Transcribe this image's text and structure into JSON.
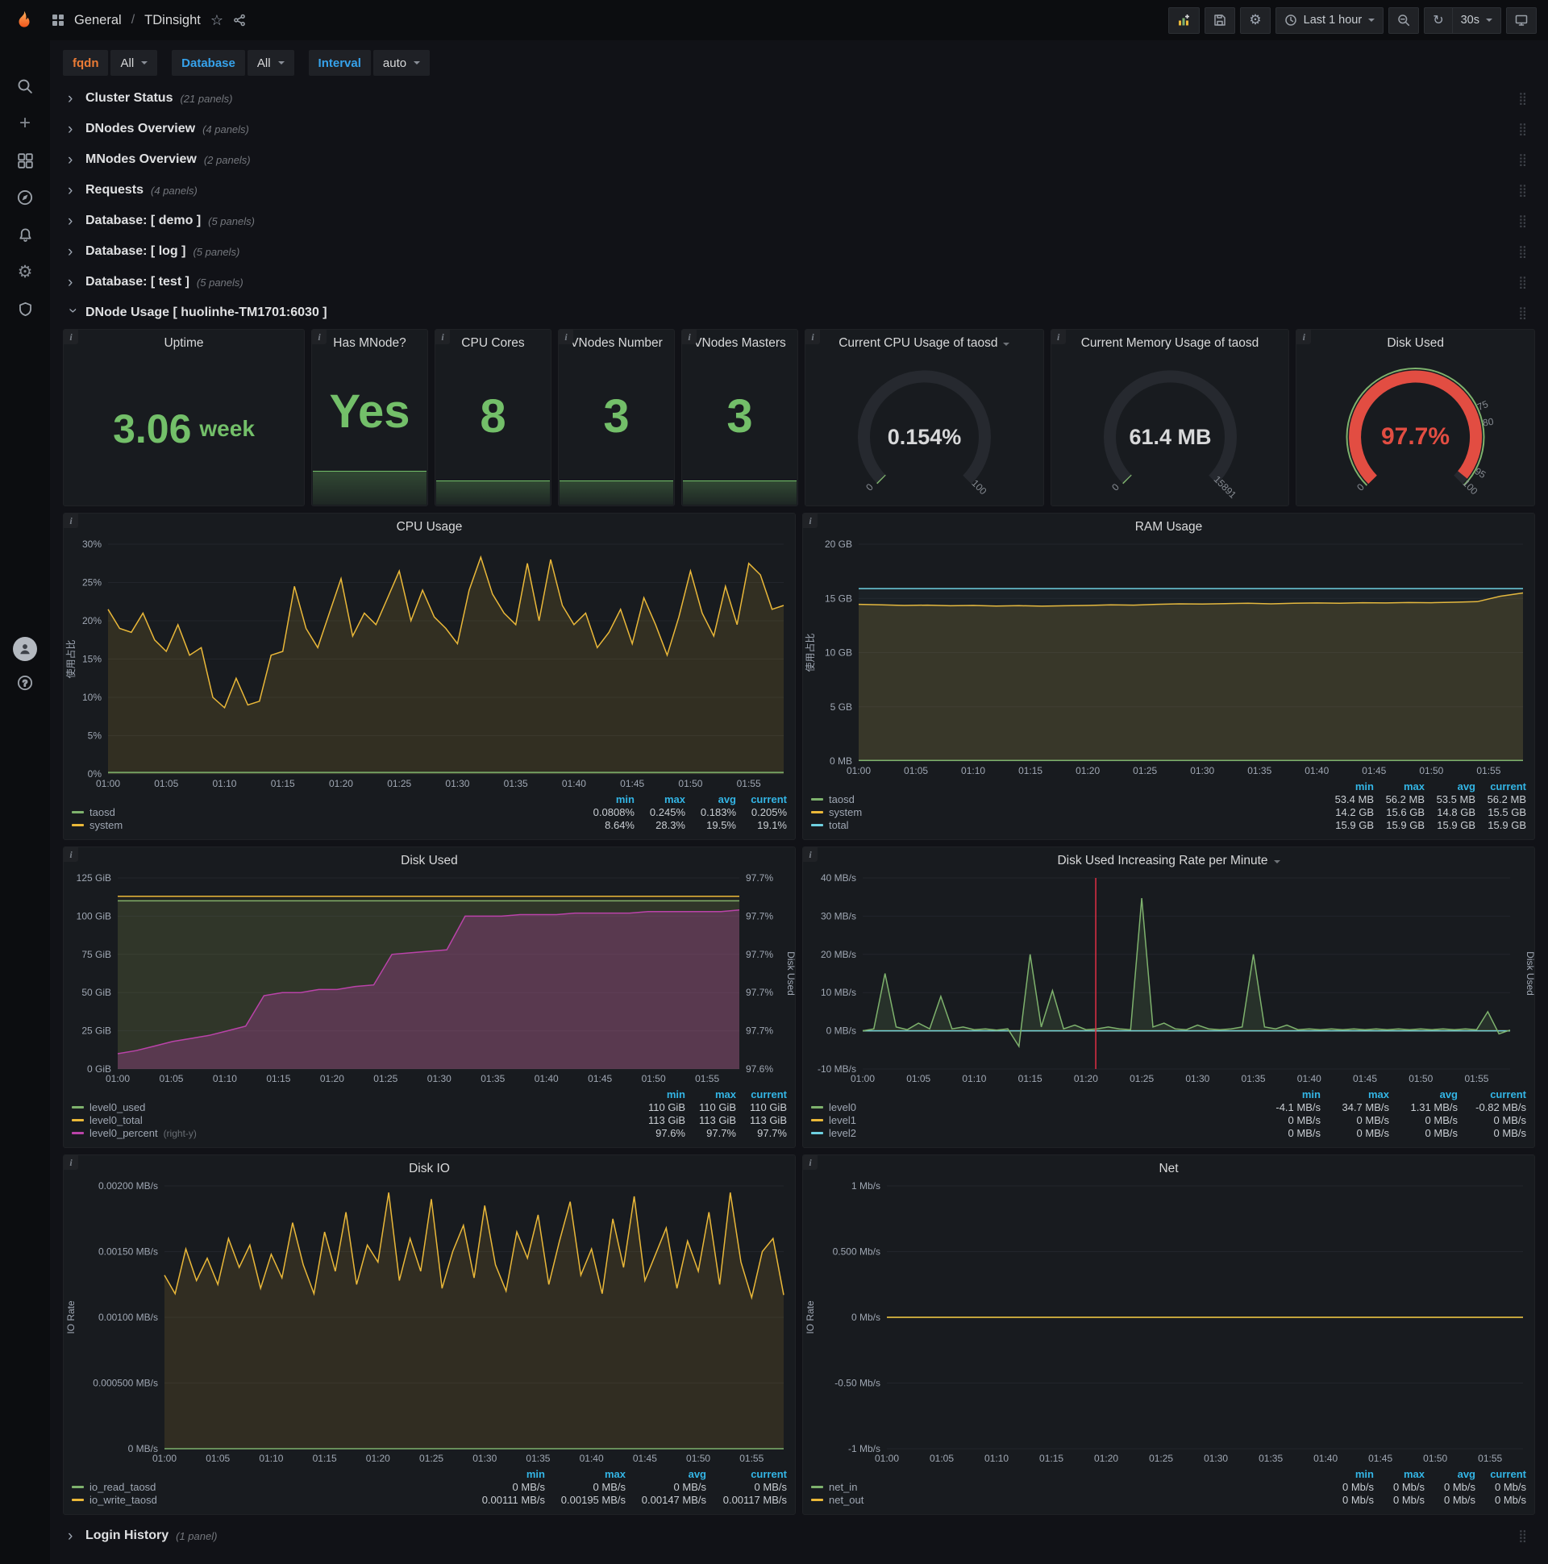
{
  "navbar": {
    "section": "General",
    "separator": "/",
    "dashboard": "TDinsight",
    "time_range": "Last 1 hour",
    "refresh": "30s"
  },
  "filters": {
    "fqdn_label": "fqdn",
    "fqdn_value": "All",
    "database_label": "Database",
    "database_value": "All",
    "interval_label": "Interval",
    "interval_value": "auto"
  },
  "rows": [
    {
      "title": "Cluster Status",
      "count": "(21 panels)"
    },
    {
      "title": "DNodes Overview",
      "count": "(4 panels)"
    },
    {
      "title": "MNodes Overview",
      "count": "(2 panels)"
    },
    {
      "title": "Requests",
      "count": "(4 panels)"
    },
    {
      "title": "Database: [ demo ]",
      "count": "(5 panels)"
    },
    {
      "title": "Database: [ log ]",
      "count": "(5 panels)"
    },
    {
      "title": "Database: [ test ]",
      "count": "(5 panels)"
    }
  ],
  "dnode_row": {
    "title": "DNode Usage [ huolinhe-TM1701:6030 ]"
  },
  "login_row": {
    "title": "Login History",
    "count": "(1 panel)"
  },
  "stats": {
    "uptime": {
      "title": "Uptime",
      "value": "3.06",
      "unit": "week"
    },
    "has_mnode": {
      "title": "Has MNode?",
      "value": "Yes"
    },
    "cpu_cores": {
      "title": "CPU Cores",
      "value": "8"
    },
    "vnodes_number": {
      "title": "VNodes Number",
      "value": "3"
    },
    "vnod​es_masters": {
      "title": "VNodes Masters",
      "value": "3"
    },
    "vnodes_masters": {
      "title": "VNodes Masters",
      "value": "3"
    }
  },
  "gauges": {
    "cpu": {
      "title": "Current CPU Usage of taosd",
      "display": "0.154%",
      "value": 0.154,
      "min": 0,
      "max": 100,
      "color": "#7EB26D",
      "valueColor": "#d8d9da",
      "labels": [
        {
          "frac": 0,
          "text": "0"
        },
        {
          "frac": 1,
          "text": "100"
        }
      ]
    },
    "mem": {
      "title": "Current Memory Usage of taosd",
      "display": "61.4 MB",
      "value": 61.4,
      "min": 0,
      "max": 15891,
      "color": "#7EB26D",
      "valueColor": "#d8d9da",
      "labels": [
        {
          "frac": 0,
          "text": "0"
        },
        {
          "frac": 1,
          "text": "15891"
        }
      ]
    },
    "disk": {
      "title": "Disk Used",
      "display": "97.7%",
      "value": 97.7,
      "min": 0,
      "max": 100,
      "color": "#E24D42",
      "valueColor": "#E24D42",
      "valueSize": 30,
      "outer": "#7EB26D",
      "labels": [
        {
          "frac": 0,
          "text": "0"
        },
        {
          "frac": 0.75,
          "text": "75"
        },
        {
          "frac": 0.8,
          "text": "80"
        },
        {
          "frac": 0.95,
          "text": "95"
        },
        {
          "frac": 1,
          "text": "100"
        }
      ]
    }
  },
  "charts": {
    "time_ticks": [
      "01:00",
      "01:05",
      "01:10",
      "01:15",
      "01:20",
      "01:25",
      "01:30",
      "01:35",
      "01:40",
      "01:45",
      "01:50",
      "01:55"
    ],
    "cpu": {
      "title": "CPU Usage",
      "ylabel": "使用占比",
      "ymin": 0,
      "ymax": 30,
      "yticks": [
        "0%",
        "5%",
        "10%",
        "15%",
        "20%",
        "25%",
        "30%"
      ],
      "series": [
        {
          "name": "system",
          "color": "#EAB839",
          "fill": 0.13,
          "values": [
            21.5,
            19,
            18.5,
            21,
            17.5,
            16,
            19.5,
            15.5,
            16.5,
            10,
            8.64,
            12.5,
            9,
            9.5,
            15.5,
            16,
            24.5,
            19,
            16.5,
            21,
            25.5,
            18,
            21,
            19.5,
            23,
            26.5,
            20,
            24,
            20.5,
            19,
            17,
            24,
            28.3,
            23.5,
            21,
            19.5,
            27.5,
            20,
            28,
            22,
            19.5,
            21,
            16.5,
            18.5,
            21.5,
            17,
            23,
            19.5,
            15.5,
            20.5,
            26.5,
            21,
            18,
            24.5,
            19.5,
            27.5,
            26,
            21.5,
            22
          ]
        },
        {
          "name": "taosd",
          "color": "#7EB26D",
          "fill": 0.1,
          "values": [
            0.2,
            0.2
          ]
        }
      ],
      "legend": {
        "columns": [
          "min",
          "max",
          "avg",
          "current"
        ],
        "rows": [
          {
            "name": "taosd",
            "color": "#7EB26D",
            "values": [
              "0.0808%",
              "0.245%",
              "0.183%",
              "0.205%"
            ]
          },
          {
            "name": "system",
            "color": "#EAB839",
            "values": [
              "8.64%",
              "28.3%",
              "19.5%",
              "19.1%"
            ]
          }
        ]
      }
    },
    "ram": {
      "title": "RAM Usage",
      "ylabel": "使用占比",
      "ymin": 0,
      "ymax": 20,
      "yticks": [
        "0 MB",
        "5 GB",
        "10 GB",
        "15 GB",
        "20 GB"
      ],
      "series": [
        {
          "name": "system",
          "color": "#EAB839",
          "fill": 0.15,
          "values": [
            14.45,
            14.4,
            14.35,
            14.38,
            14.32,
            14.35,
            14.3,
            14.33,
            14.28,
            14.32,
            14.35,
            14.4,
            14.38,
            14.45,
            14.5,
            14.48,
            14.52,
            14.55,
            14.5,
            14.55,
            14.58,
            14.55,
            14.6,
            14.58,
            14.62,
            14.6,
            14.65,
            14.7,
            15.2,
            15.5
          ]
        },
        {
          "name": "total",
          "color": "#6ED0E0",
          "fill": 0.04,
          "values": [
            15.9,
            15.9
          ]
        },
        {
          "name": "taosd",
          "color": "#7EB26D",
          "fill": 0,
          "values": [
            0.055,
            0.055
          ]
        }
      ],
      "legend": {
        "columns": [
          "min",
          "max",
          "avg",
          "current"
        ],
        "rows": [
          {
            "name": "taosd",
            "color": "#7EB26D",
            "values": [
              "53.4 MB",
              "56.2 MB",
              "53.5 MB",
              "56.2 MB"
            ]
          },
          {
            "name": "system",
            "color": "#EAB839",
            "values": [
              "14.2 GB",
              "15.6 GB",
              "14.8 GB",
              "15.5 GB"
            ]
          },
          {
            "name": "total",
            "color": "#6ED0E0",
            "values": [
              "15.9 GB",
              "15.9 GB",
              "15.9 GB",
              "15.9 GB"
            ]
          }
        ]
      }
    },
    "disk": {
      "title": "Disk Used",
      "ymin": 0,
      "ymax": 125,
      "yticks": [
        "0 GiB",
        "25 GiB",
        "50 GiB",
        "75 GiB",
        "100 GiB",
        "125 GiB"
      ],
      "y2min": 97.6,
      "y2max": 97.725,
      "y2ticks": [
        "97.6%",
        "97.7%",
        "97.7%",
        "97.7%",
        "97.7%",
        "97.7%"
      ],
      "y2label": "Disk Used",
      "series": [
        {
          "name": "level0_used",
          "color": "#7EB26D",
          "fill": 0.14,
          "values": [
            110,
            110
          ]
        },
        {
          "name": "level0_total",
          "color": "#EAB839",
          "fill": 0.05,
          "values": [
            113,
            113
          ]
        },
        {
          "name": "level0_percent",
          "color": "#BA43A9",
          "axis": "right",
          "fill": 0.3,
          "values": [
            97.61,
            97.612,
            97.615,
            97.618,
            97.62,
            97.622,
            97.625,
            97.628,
            97.648,
            97.65,
            97.65,
            97.652,
            97.652,
            97.654,
            97.655,
            97.675,
            97.676,
            97.677,
            97.678,
            97.7,
            97.7,
            97.7,
            97.701,
            97.701,
            97.701,
            97.702,
            97.702,
            97.702,
            97.702,
            97.703,
            97.703,
            97.703,
            97.703,
            97.703,
            97.704
          ]
        }
      ],
      "legend": {
        "columns": [
          "min",
          "max",
          "current"
        ],
        "rows": [
          {
            "name": "level0_used",
            "color": "#7EB26D",
            "values": [
              "110 GiB",
              "110 GiB",
              "110 GiB"
            ]
          },
          {
            "name": "level0_total",
            "color": "#EAB839",
            "values": [
              "113 GiB",
              "113 GiB",
              "113 GiB"
            ]
          },
          {
            "name": "level0_percent",
            "color": "#BA43A9",
            "note": "(right-y)",
            "values": [
              "97.6%",
              "97.7%",
              "97.7%"
            ]
          }
        ]
      }
    },
    "disk_rate": {
      "title": "Disk Used Increasing Rate per Minute",
      "ymin": -10,
      "ymax": 40,
      "yticks": [
        "-10 MB/s",
        "0 MB/s",
        "10 MB/s",
        "20 MB/s",
        "30 MB/s",
        "40 MB/s"
      ],
      "y2label": "Disk Used",
      "vline": 0.36,
      "series": [
        {
          "name": "level1",
          "color": "#EAB839",
          "fill": 0,
          "values": [
            0,
            0
          ]
        },
        {
          "name": "level2",
          "color": "#6ED0E0",
          "fill": 0,
          "values": [
            0,
            0
          ]
        },
        {
          "name": "level0",
          "color": "#7EB26D",
          "fill": 0.15,
          "values": [
            0,
            0.5,
            15,
            1,
            0.3,
            2,
            0.5,
            9,
            0.5,
            1,
            0.3,
            0.5,
            0.2,
            0.5,
            -4.1,
            20,
            1,
            10.5,
            0.5,
            1.5,
            0.3,
            0.5,
            1,
            0.5,
            0.3,
            34.7,
            1,
            2,
            0.5,
            0.3,
            1.5,
            0.5,
            0.3,
            0.5,
            1,
            20,
            1,
            0.5,
            1.5,
            0.3,
            0.5,
            0.3,
            0.5,
            0.3,
            0.5,
            0.3,
            0.5,
            0.3,
            0.5,
            0.3,
            0.5,
            0.3,
            0.5,
            0.3,
            0.5,
            0.3,
            5,
            -0.82,
            0.2
          ]
        }
      ],
      "legend": {
        "columns": [
          "min",
          "max",
          "avg",
          "current"
        ],
        "rows": [
          {
            "name": "level0",
            "color": "#7EB26D",
            "values": [
              "-4.1 MB/s",
              "34.7 MB/s",
              "1.31 MB/s",
              "-0.82 MB/s"
            ]
          },
          {
            "name": "level1",
            "color": "#EAB839",
            "values": [
              "0 MB/s",
              "0 MB/s",
              "0 MB/s",
              "0 MB/s"
            ]
          },
          {
            "name": "level2",
            "color": "#6ED0E0",
            "values": [
              "0 MB/s",
              "0 MB/s",
              "0 MB/s",
              "0 MB/s"
            ]
          }
        ]
      }
    },
    "disk_io": {
      "title": "Disk IO",
      "ylabel": "IO Rate",
      "ymin": 0,
      "ymax": 0.002,
      "yticks": [
        "0 MB/s",
        "0.000500 MB/s",
        "0.00100 MB/s",
        "0.00150 MB/s",
        "0.00200 MB/s"
      ],
      "series": [
        {
          "name": "io_write_taosd",
          "color": "#EAB839",
          "fill": 0.12,
          "values": [
            0.00132,
            0.00118,
            0.00152,
            0.00128,
            0.00145,
            0.00125,
            0.0016,
            0.00138,
            0.00155,
            0.00122,
            0.00148,
            0.0013,
            0.00172,
            0.0014,
            0.00118,
            0.00165,
            0.00135,
            0.0018,
            0.00125,
            0.00155,
            0.00142,
            0.00195,
            0.00128,
            0.0016,
            0.00135,
            0.0019,
            0.00122,
            0.0015,
            0.0017,
            0.0013,
            0.00185,
            0.0014,
            0.0012,
            0.00165,
            0.00145,
            0.00178,
            0.00125,
            0.00158,
            0.00188,
            0.00132,
            0.00152,
            0.00118,
            0.00175,
            0.00138,
            0.00192,
            0.00128,
            0.00148,
            0.00168,
            0.00122,
            0.00158,
            0.00135,
            0.0018,
            0.00125,
            0.00195,
            0.00142,
            0.00115,
            0.0015,
            0.0016,
            0.00117
          ]
        },
        {
          "name": "io_read_taosd",
          "color": "#7EB26D",
          "fill": 0,
          "values": [
            0,
            0
          ]
        }
      ],
      "legend": {
        "columns": [
          "min",
          "max",
          "avg",
          "current"
        ],
        "rows": [
          {
            "name": "io_read_taosd",
            "color": "#7EB26D",
            "values": [
              "0 MB/s",
              "0 MB/s",
              "0 MB/s",
              "0 MB/s"
            ]
          },
          {
            "name": "io_write_taosd",
            "color": "#EAB839",
            "values": [
              "0.00111 MB/s",
              "0.00195 MB/s",
              "0.00147 MB/s",
              "0.00117 MB/s"
            ]
          }
        ]
      }
    },
    "net": {
      "title": "Net",
      "ylabel": "IO Rate",
      "ymin": -1,
      "ymax": 1,
      "yticks": [
        "-1 Mb/s",
        "-0.50 Mb/s",
        "0 Mb/s",
        "0.500 Mb/s",
        "1 Mb/s"
      ],
      "series": [
        {
          "name": "net_in",
          "color": "#7EB26D",
          "fill": 0,
          "values": [
            0,
            0
          ]
        },
        {
          "name": "net_out",
          "color": "#EAB839",
          "fill": 0,
          "values": [
            0,
            0
          ]
        }
      ],
      "legend": {
        "columns": [
          "min",
          "max",
          "avg",
          "current"
        ],
        "rows": [
          {
            "name": "net_in",
            "color": "#7EB26D",
            "values": [
              "0 Mb/s",
              "0 Mb/s",
              "0 Mb/s",
              "0 Mb/s"
            ]
          },
          {
            "name": "net_out",
            "color": "#EAB839",
            "values": [
              "0 Mb/s",
              "0 Mb/s",
              "0 Mb/s",
              "0 Mb/s"
            ]
          }
        ]
      }
    }
  }
}
